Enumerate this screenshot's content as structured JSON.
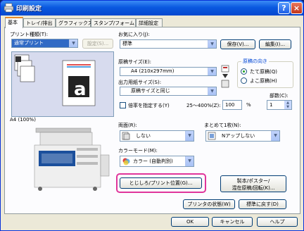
{
  "window": {
    "title": "印刷設定"
  },
  "tabs": [
    "基本",
    "トレイ/排出",
    "グラフィックス",
    "スタンプ/フォーム",
    "詳細設定"
  ],
  "print_type": {
    "label": "プリント種類(T):",
    "value": "通常プリント",
    "settings_button": "設定(S)..."
  },
  "favorites": {
    "label": "お気に入り(J):",
    "value": "標準",
    "save_button": "保存(V)...",
    "edit_button": "編集(I)..."
  },
  "original_size": {
    "label": "原稿サイズ(E):",
    "value": "A4 (210x297mm)"
  },
  "output_size": {
    "label": "出力用紙サイズ(S):",
    "value": "原稿サイズと同じ"
  },
  "scale": {
    "checkbox_label": "倍率を指定する(Y)",
    "range": "25〜400%(Z):",
    "value": "100",
    "unit": "%"
  },
  "orientation": {
    "title": "原稿の向き",
    "options": [
      "たて原稿(Q)",
      "よこ原稿(H)"
    ],
    "selected": 0
  },
  "copies": {
    "label": "部数(C):",
    "value": "1"
  },
  "preview": {
    "caption": "A4 (100%)",
    "letter": "a"
  },
  "duplex": {
    "label": "両面(R):",
    "value": "しない"
  },
  "nup": {
    "label": "まとめて1枚(N):",
    "value": "Nアップしない"
  },
  "color_mode": {
    "label": "カラーモード(M):",
    "value": "カラー (自動判別)"
  },
  "buttons": {
    "binding": "とじしろ/プリント位置(G)...",
    "booklet_line1": "製本/ポスター/",
    "booklet_line2": "混在原稿/回転(K)...",
    "printer_status": "プリンタの状態(W)",
    "defaults": "標準に戻す(D)",
    "ok": "OK",
    "cancel": "キャンセル",
    "help": "ヘルプ"
  },
  "colors": {
    "title_bar": "#0a59e0",
    "highlight": "#e0359b",
    "selection": "#316ac5"
  }
}
